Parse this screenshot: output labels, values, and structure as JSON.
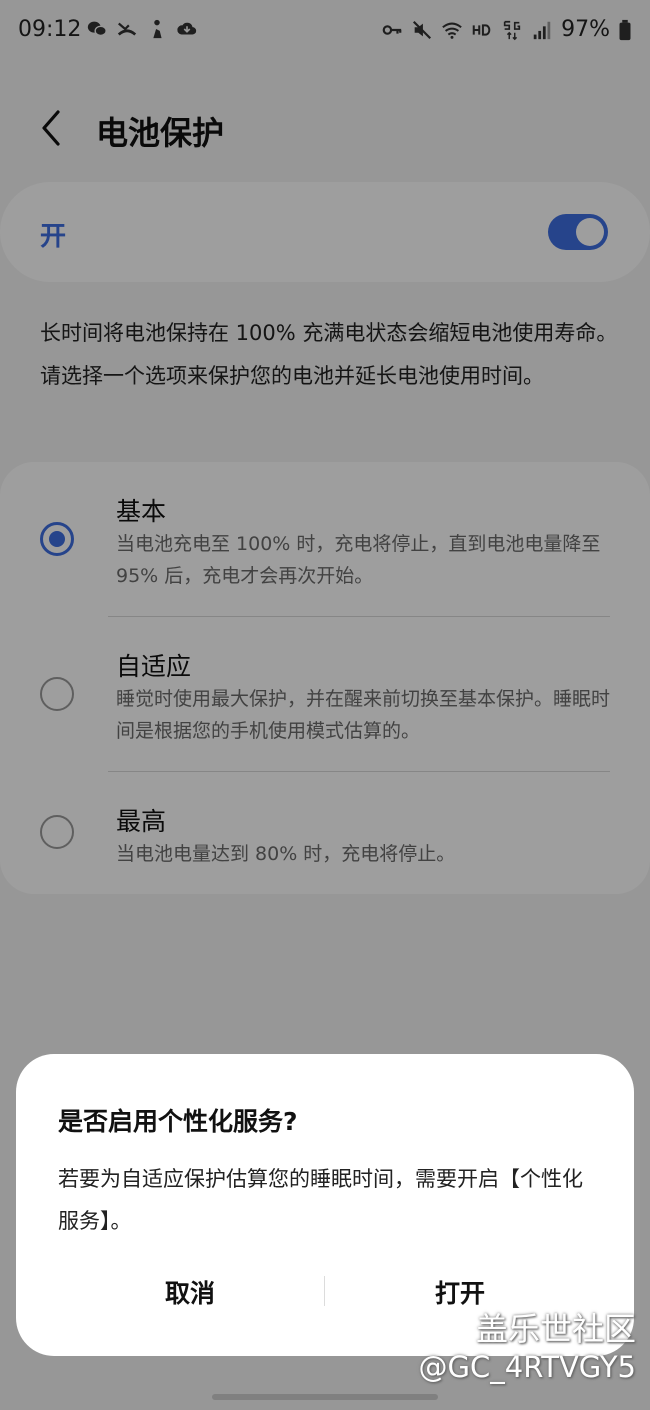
{
  "status_bar": {
    "time": "09:12",
    "left_icons": [
      "wechat-icon",
      "missed-call-icon",
      "person-walk-icon",
      "cloud-download-icon"
    ],
    "right_icons": [
      "key-icon",
      "mute-icon",
      "wifi-icon",
      "hd-icon",
      "5g-icon",
      "signal-icon",
      "battery-icon"
    ],
    "battery": "97%"
  },
  "header": {
    "title": "电池保护"
  },
  "master_toggle": {
    "label": "开",
    "on": true,
    "accent": "#3e6ee0"
  },
  "description": "长时间将电池保持在 100% 充满电状态会缩短电池使用寿命。请选择一个选项来保护您的电池并延长电池使用时间。",
  "options": [
    {
      "title": "基本",
      "subtitle": "当电池充电至 100% 时，充电将停止，直到电池电量降至 95% 后，充电才会再次开始。",
      "selected": true
    },
    {
      "title": "自适应",
      "subtitle": "睡觉时使用最大保护，并在醒来前切换至基本保护。睡眠时间是根据您的手机使用模式估算的。",
      "selected": false
    },
    {
      "title": "最高",
      "subtitle": "当电池电量达到 80% 时，充电将停止。",
      "selected": false
    }
  ],
  "dialog": {
    "title": "是否启用个性化服务?",
    "body": "若要为自适应保护估算您的睡眠时间，需要开启【个性化服务】。",
    "cancel_label": "取消",
    "confirm_label": "打开"
  },
  "watermark": {
    "line1": "盖乐世社区",
    "line2": "@GC_4RTVGY5"
  }
}
